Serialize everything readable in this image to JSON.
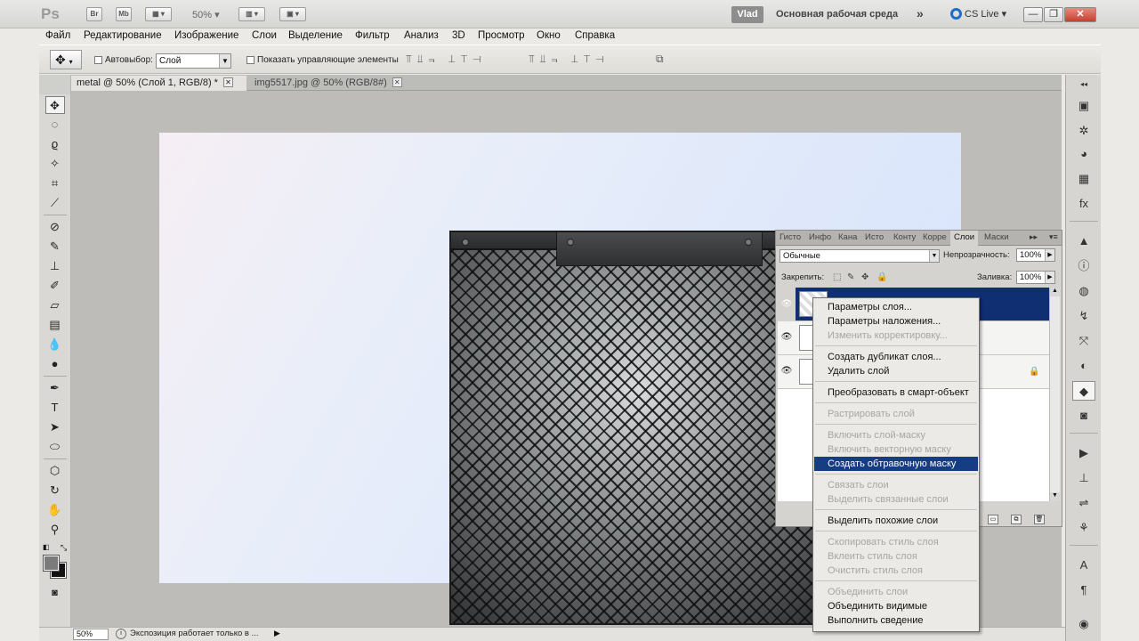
{
  "appbar": {
    "logo": "Ps",
    "br_label": "Br",
    "mb_label": "Mb",
    "zoom": "50%",
    "user": "Vlad",
    "workspace": "Основная рабочая среда",
    "more": "»",
    "cs_live": "CS Live",
    "cs_live_arrow": "▾",
    "minimize": "—",
    "restore": "❐",
    "close": "✕"
  },
  "menu": [
    "Файл",
    "Редактирование",
    "Изображение",
    "Слои",
    "Выделение",
    "Фильтр",
    "Анализ",
    "3D",
    "Просмотр",
    "Окно",
    "Справка"
  ],
  "options": {
    "auto_select_label": "Автовыбор:",
    "auto_select_value": "Слой",
    "show_controls_label": "Показать управляющие элементы"
  },
  "tabs": [
    {
      "label": "metal @ 50% (Слой 1, RGB/8) *",
      "active": true
    },
    {
      "label": "img5517.jpg @ 50% (RGB/8#)",
      "active": false
    }
  ],
  "status": {
    "zoom": "50%",
    "text": "Экспозиция работает только в ..."
  },
  "layers_panel": {
    "tabs": [
      "Гисто",
      "Инфо",
      "Кана",
      "Исто",
      "Конту",
      "Корре",
      "Слои",
      "Маски"
    ],
    "active_tab": "Слои",
    "blend_mode": "Обычные",
    "opacity_label": "Непрозрачность:",
    "opacity": "100%",
    "lock_label": "Закрепить:",
    "fill_label": "Заливка:",
    "fill": "100%"
  },
  "context_menu": [
    {
      "label": "Параметры слоя...",
      "state": "enabled"
    },
    {
      "label": "Параметры наложения...",
      "state": "enabled"
    },
    {
      "label": "Изменить корректировку...",
      "state": "disabled"
    },
    {
      "sep": true
    },
    {
      "label": "Создать дубликат слоя...",
      "state": "enabled"
    },
    {
      "label": "Удалить слой",
      "state": "enabled"
    },
    {
      "sep": true
    },
    {
      "label": "Преобразовать в смарт-объект",
      "state": "enabled"
    },
    {
      "sep": true
    },
    {
      "label": "Растрировать слой",
      "state": "disabled"
    },
    {
      "sep": true
    },
    {
      "label": "Включить слой-маску",
      "state": "disabled"
    },
    {
      "label": "Включить векторную маску",
      "state": "disabled"
    },
    {
      "label": "Создать обтравочную маску",
      "state": "highlighted"
    },
    {
      "sep": true
    },
    {
      "label": "Связать слои",
      "state": "disabled"
    },
    {
      "label": "Выделить связанные слои",
      "state": "disabled"
    },
    {
      "sep": true
    },
    {
      "label": "Выделить похожие слои",
      "state": "enabled"
    },
    {
      "sep": true
    },
    {
      "label": "Скопировать стиль слоя",
      "state": "disabled"
    },
    {
      "label": "Вклеить стиль слоя",
      "state": "disabled"
    },
    {
      "label": "Очистить стиль слоя",
      "state": "disabled"
    },
    {
      "sep": true
    },
    {
      "label": "Объединить слои",
      "state": "disabled"
    },
    {
      "label": "Объединить видимые",
      "state": "enabled"
    },
    {
      "label": "Выполнить сведение",
      "state": "enabled"
    }
  ],
  "toolbar_icons": [
    "move-icon",
    "marquee-icon",
    "lasso-icon",
    "quick-select-icon",
    "crop-icon",
    "eyedropper-icon",
    "healing-brush-icon",
    "brush-icon",
    "clone-stamp-icon",
    "history-brush-icon",
    "eraser-icon",
    "gradient-icon",
    "blur-icon",
    "dodge-icon",
    "pen-icon",
    "type-icon",
    "path-select-icon",
    "shape-icon",
    "3d-rotate-icon",
    "3d-orbit-icon",
    "hand-icon",
    "zoom-icon"
  ],
  "colors": {
    "selection": "#163c82",
    "foreground": "#7b7b7b",
    "background": "#111111"
  }
}
